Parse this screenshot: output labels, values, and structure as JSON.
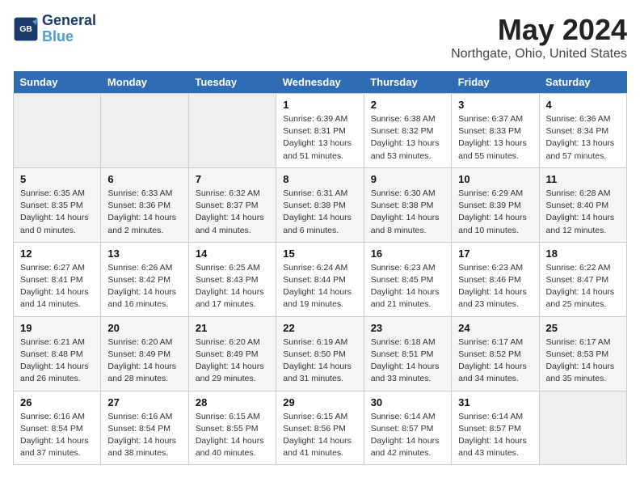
{
  "header": {
    "logo_line1": "General",
    "logo_line2": "Blue",
    "month": "May 2024",
    "location": "Northgate, Ohio, United States"
  },
  "days_of_week": [
    "Sunday",
    "Monday",
    "Tuesday",
    "Wednesday",
    "Thursday",
    "Friday",
    "Saturday"
  ],
  "weeks": [
    [
      {
        "day": "",
        "info": ""
      },
      {
        "day": "",
        "info": ""
      },
      {
        "day": "",
        "info": ""
      },
      {
        "day": "1",
        "info": "Sunrise: 6:39 AM\nSunset: 8:31 PM\nDaylight: 13 hours\nand 51 minutes."
      },
      {
        "day": "2",
        "info": "Sunrise: 6:38 AM\nSunset: 8:32 PM\nDaylight: 13 hours\nand 53 minutes."
      },
      {
        "day": "3",
        "info": "Sunrise: 6:37 AM\nSunset: 8:33 PM\nDaylight: 13 hours\nand 55 minutes."
      },
      {
        "day": "4",
        "info": "Sunrise: 6:36 AM\nSunset: 8:34 PM\nDaylight: 13 hours\nand 57 minutes."
      }
    ],
    [
      {
        "day": "5",
        "info": "Sunrise: 6:35 AM\nSunset: 8:35 PM\nDaylight: 14 hours\nand 0 minutes."
      },
      {
        "day": "6",
        "info": "Sunrise: 6:33 AM\nSunset: 8:36 PM\nDaylight: 14 hours\nand 2 minutes."
      },
      {
        "day": "7",
        "info": "Sunrise: 6:32 AM\nSunset: 8:37 PM\nDaylight: 14 hours\nand 4 minutes."
      },
      {
        "day": "8",
        "info": "Sunrise: 6:31 AM\nSunset: 8:38 PM\nDaylight: 14 hours\nand 6 minutes."
      },
      {
        "day": "9",
        "info": "Sunrise: 6:30 AM\nSunset: 8:38 PM\nDaylight: 14 hours\nand 8 minutes."
      },
      {
        "day": "10",
        "info": "Sunrise: 6:29 AM\nSunset: 8:39 PM\nDaylight: 14 hours\nand 10 minutes."
      },
      {
        "day": "11",
        "info": "Sunrise: 6:28 AM\nSunset: 8:40 PM\nDaylight: 14 hours\nand 12 minutes."
      }
    ],
    [
      {
        "day": "12",
        "info": "Sunrise: 6:27 AM\nSunset: 8:41 PM\nDaylight: 14 hours\nand 14 minutes."
      },
      {
        "day": "13",
        "info": "Sunrise: 6:26 AM\nSunset: 8:42 PM\nDaylight: 14 hours\nand 16 minutes."
      },
      {
        "day": "14",
        "info": "Sunrise: 6:25 AM\nSunset: 8:43 PM\nDaylight: 14 hours\nand 17 minutes."
      },
      {
        "day": "15",
        "info": "Sunrise: 6:24 AM\nSunset: 8:44 PM\nDaylight: 14 hours\nand 19 minutes."
      },
      {
        "day": "16",
        "info": "Sunrise: 6:23 AM\nSunset: 8:45 PM\nDaylight: 14 hours\nand 21 minutes."
      },
      {
        "day": "17",
        "info": "Sunrise: 6:23 AM\nSunset: 8:46 PM\nDaylight: 14 hours\nand 23 minutes."
      },
      {
        "day": "18",
        "info": "Sunrise: 6:22 AM\nSunset: 8:47 PM\nDaylight: 14 hours\nand 25 minutes."
      }
    ],
    [
      {
        "day": "19",
        "info": "Sunrise: 6:21 AM\nSunset: 8:48 PM\nDaylight: 14 hours\nand 26 minutes."
      },
      {
        "day": "20",
        "info": "Sunrise: 6:20 AM\nSunset: 8:49 PM\nDaylight: 14 hours\nand 28 minutes."
      },
      {
        "day": "21",
        "info": "Sunrise: 6:20 AM\nSunset: 8:49 PM\nDaylight: 14 hours\nand 29 minutes."
      },
      {
        "day": "22",
        "info": "Sunrise: 6:19 AM\nSunset: 8:50 PM\nDaylight: 14 hours\nand 31 minutes."
      },
      {
        "day": "23",
        "info": "Sunrise: 6:18 AM\nSunset: 8:51 PM\nDaylight: 14 hours\nand 33 minutes."
      },
      {
        "day": "24",
        "info": "Sunrise: 6:17 AM\nSunset: 8:52 PM\nDaylight: 14 hours\nand 34 minutes."
      },
      {
        "day": "25",
        "info": "Sunrise: 6:17 AM\nSunset: 8:53 PM\nDaylight: 14 hours\nand 35 minutes."
      }
    ],
    [
      {
        "day": "26",
        "info": "Sunrise: 6:16 AM\nSunset: 8:54 PM\nDaylight: 14 hours\nand 37 minutes."
      },
      {
        "day": "27",
        "info": "Sunrise: 6:16 AM\nSunset: 8:54 PM\nDaylight: 14 hours\nand 38 minutes."
      },
      {
        "day": "28",
        "info": "Sunrise: 6:15 AM\nSunset: 8:55 PM\nDaylight: 14 hours\nand 40 minutes."
      },
      {
        "day": "29",
        "info": "Sunrise: 6:15 AM\nSunset: 8:56 PM\nDaylight: 14 hours\nand 41 minutes."
      },
      {
        "day": "30",
        "info": "Sunrise: 6:14 AM\nSunset: 8:57 PM\nDaylight: 14 hours\nand 42 minutes."
      },
      {
        "day": "31",
        "info": "Sunrise: 6:14 AM\nSunset: 8:57 PM\nDaylight: 14 hours\nand 43 minutes."
      },
      {
        "day": "",
        "info": ""
      }
    ]
  ]
}
